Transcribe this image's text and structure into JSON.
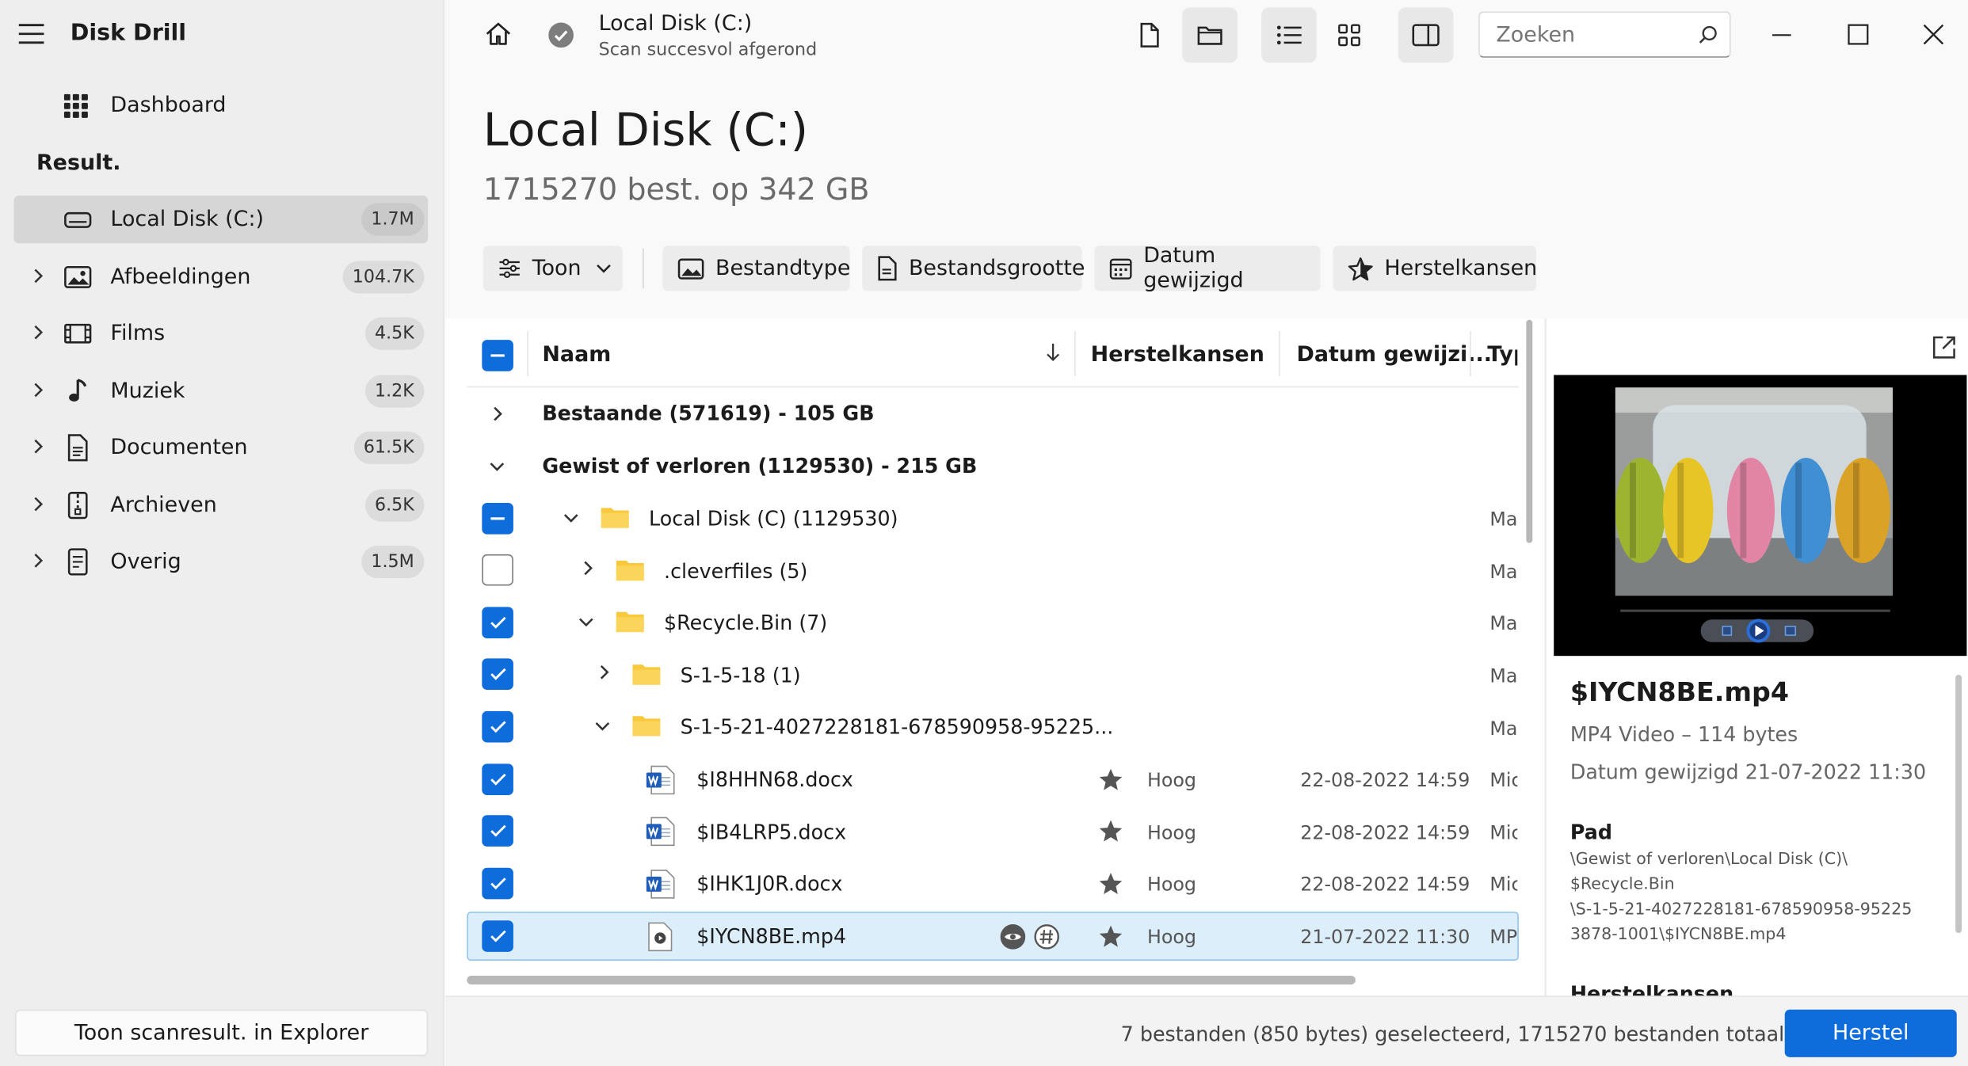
{
  "app": {
    "title": "Disk Drill"
  },
  "sidebar": {
    "dashboard_label": "Dashboard",
    "section_label": "Result.",
    "items": [
      {
        "label": "Local Disk (C:)",
        "count": "1.7M",
        "icon": "drive-icon"
      },
      {
        "label": "Afbeeldingen",
        "count": "104.7K",
        "icon": "image-icon"
      },
      {
        "label": "Films",
        "count": "4.5K",
        "icon": "film-icon"
      },
      {
        "label": "Muziek",
        "count": "1.2K",
        "icon": "music-note-icon"
      },
      {
        "label": "Documenten",
        "count": "61.5K",
        "icon": "document-icon"
      },
      {
        "label": "Archieven",
        "count": "6.5K",
        "icon": "archive-icon"
      },
      {
        "label": "Overig",
        "count": "1.5M",
        "icon": "other-file-icon"
      }
    ],
    "explorer_button": "Toon scanresult. in Explorer"
  },
  "topbar": {
    "disk_title": "Local Disk (C:)",
    "scan_status": "Scan succesvol afgerond",
    "search_placeholder": "Zoeken"
  },
  "main": {
    "title": "Local Disk (C:)",
    "subtitle": "1715270 best. op 342 GB",
    "filters": {
      "show": "Toon",
      "filetype": "Bestandtype",
      "filesize": "Bestandsgrootte",
      "date": "Datum gewijzigd",
      "recovery": "Herstelkansen"
    },
    "columns": {
      "name": "Naam",
      "recovery": "Herstelkansen",
      "date": "Datum gewijzi...",
      "type": "Typ"
    },
    "groups": {
      "existing": "Bestaande (571619) - 105 GB",
      "deleted": "Gewist of verloren (1129530) - 215 GB"
    },
    "rows": [
      {
        "name": "Local Disk (C) (1129530)",
        "type": "Ma"
      },
      {
        "name": ".cleverfiles (5)",
        "type": "Ma"
      },
      {
        "name": "$Recycle.Bin (7)",
        "type": "Ma"
      },
      {
        "name": "S-1-5-18 (1)",
        "type": "Ma"
      },
      {
        "name": "S-1-5-21-4027228181-678590958-95225...",
        "type": "Ma"
      },
      {
        "name": "$I8HHN68.docx",
        "recovery": "Hoog",
        "date": "22-08-2022 14:59",
        "type": "Mic"
      },
      {
        "name": "$IB4LRP5.docx",
        "recovery": "Hoog",
        "date": "22-08-2022 14:59",
        "type": "Mic"
      },
      {
        "name": "$IHK1J0R.docx",
        "recovery": "Hoog",
        "date": "22-08-2022 14:59",
        "type": "Mic"
      },
      {
        "name": "$IYCN8BE.mp4",
        "recovery": "Hoog",
        "date": "21-07-2022 11:30",
        "type": "MP"
      }
    ]
  },
  "preview": {
    "filename": "$IYCN8BE.mp4",
    "filetype": "MP4 Video – 114 bytes",
    "modified": "Datum gewijzigd 21-07-2022 11:30",
    "path_label": "Pad",
    "path_lines": [
      "\\Gewist of verloren\\Local Disk (C)\\",
      "$Recycle.Bin",
      "\\S-1-5-21-4027228181-678590958-95225",
      "3878-1001\\$IYCN8BE.mp4"
    ],
    "next_section": "Herstelkansen"
  },
  "footer": {
    "status": "7 bestanden (850 bytes) geselecteerd, 1715270 bestanden totaal",
    "recover_button": "Herstel"
  },
  "colors": {
    "accent": "#0f6cdb",
    "selected_row": "#ddeefb",
    "folder": "#f8c93c"
  }
}
